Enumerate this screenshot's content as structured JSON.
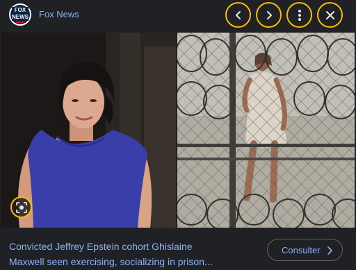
{
  "header": {
    "logo_text_top": "FOX",
    "logo_text_bottom": "NEWS",
    "source_name": "Fox News"
  },
  "controls": {
    "prev_icon": "chevron-left-icon",
    "next_icon": "chevron-right-icon",
    "more_icon": "more-vert-icon",
    "close_icon": "close-icon",
    "accent_color": "#fbbc04"
  },
  "images": {
    "lens_icon": "lens-icon"
  },
  "footer": {
    "title_line1": "Convicted Jeffrey Epstein cohort Ghislaine",
    "title_line2": "Maxwell seen exercising, socializing in prison...",
    "action_label": "Consulter",
    "link_color": "#8ab4f8"
  }
}
